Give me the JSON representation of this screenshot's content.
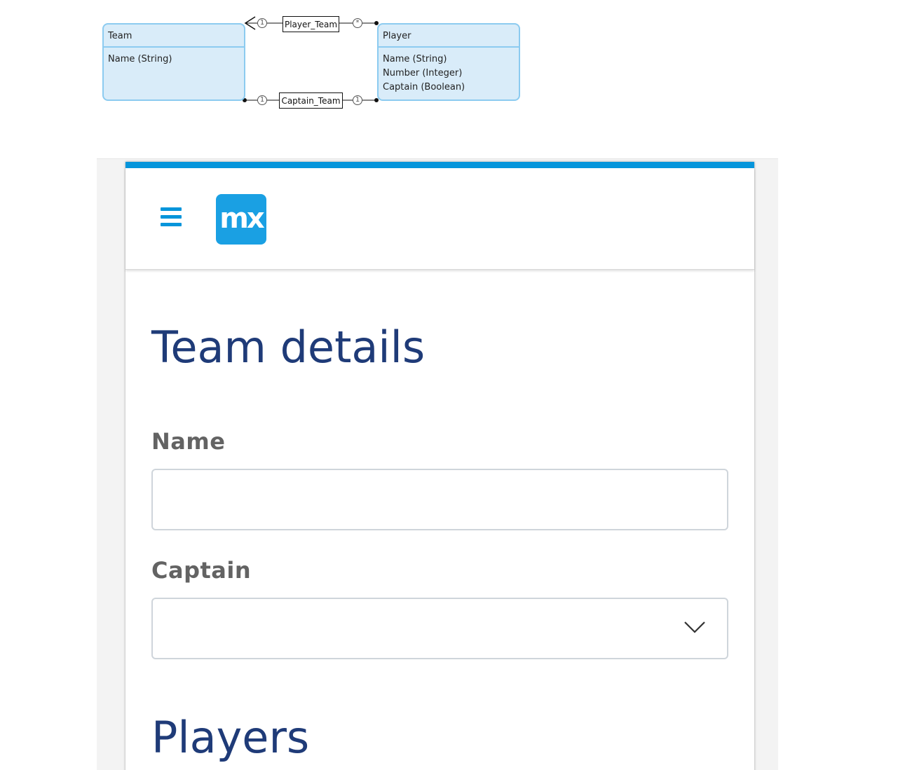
{
  "diagram": {
    "team": {
      "title": "Team",
      "attributes": [
        "Name (String)"
      ]
    },
    "player": {
      "title": "Player",
      "attributes": [
        "Name (String)",
        "Number (Integer)",
        "Captain (Boolean)"
      ]
    },
    "associations": [
      {
        "name": "Player_Team",
        "left_multiplicity": "1",
        "right_multiplicity": "*"
      },
      {
        "name": "Captain_Team",
        "left_multiplicity": "1",
        "right_multiplicity": "1"
      }
    ]
  },
  "app": {
    "logo_text": "mx",
    "page_title": "Team details",
    "fields": {
      "name_label": "Name",
      "name_value": "",
      "captain_label": "Captain",
      "captain_value": ""
    },
    "players_heading": "Players",
    "colors": {
      "accent": "#0595db",
      "heading": "#1f3b78",
      "entity_fill": "#d9ecf9",
      "entity_border": "#8ccbf0"
    }
  }
}
